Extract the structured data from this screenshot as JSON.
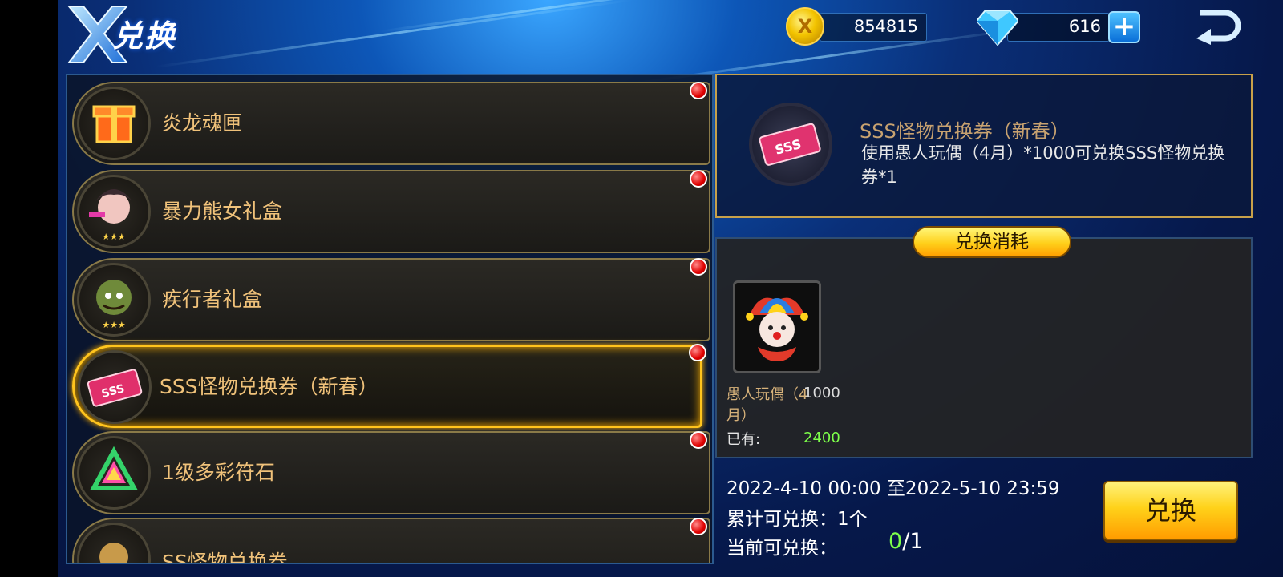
{
  "header": {
    "title": "兑换",
    "gold": "854815",
    "diamond": "616"
  },
  "list": {
    "items": [
      {
        "label": "炎龙魂匣"
      },
      {
        "label": "暴力熊女礼盒"
      },
      {
        "label": "疾行者礼盒"
      },
      {
        "label": "SSS怪物兑换券（新春）"
      },
      {
        "label": "1级多彩符石"
      },
      {
        "label": "SS怪物兑换券"
      }
    ],
    "selected_index": 3
  },
  "detail": {
    "title": "SSS怪物兑换券（新春）",
    "description": "使用愚人玩偶（4月）*1000可兑换SSS怪物兑换券*1"
  },
  "cost": {
    "header": "兑换消耗",
    "item_name": "愚人玩偶（4月）",
    "quantity": "1000",
    "owned_label": "已有:",
    "owned_value": "2400"
  },
  "footer": {
    "period": "2022-4-10 00:00 至2022-5-10 23:59",
    "total": "累计可兑换：1个",
    "current_label": "当前可兑换：",
    "current_value": "0",
    "current_max": "/1",
    "exchange_button": "兑换"
  },
  "colors": {
    "accent_gold": "#ffc41d",
    "label_text": "#f0c27a",
    "owned_green": "#7dff4a",
    "badge_red": "#e00000"
  }
}
